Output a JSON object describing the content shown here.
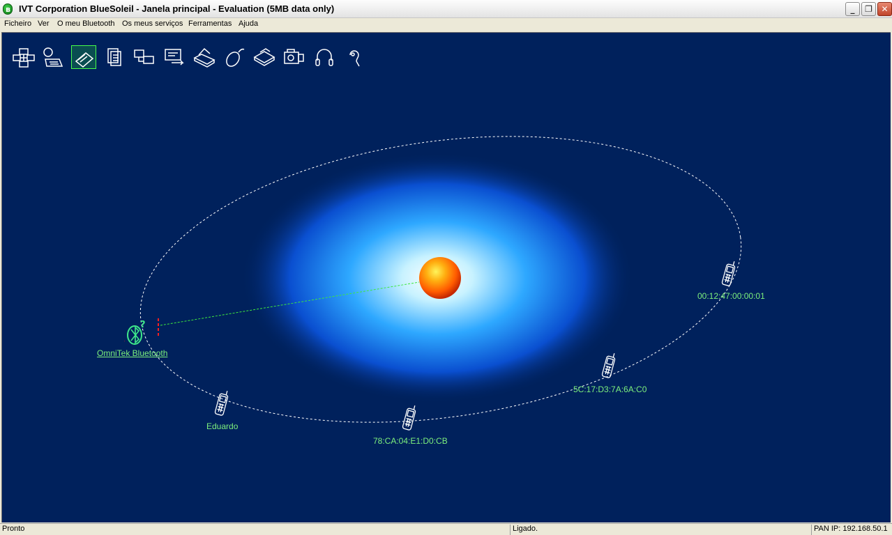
{
  "window": {
    "title": "IVT Corporation BlueSoleil - Janela principal - Evaluation (5MB data only)",
    "minimize_glyph": "_",
    "maximize_glyph": "❐",
    "close_glyph": "✕"
  },
  "menu": [
    "Ficheiro",
    "Ver",
    "O meu Bluetooth",
    "Os meus serviços",
    "Ferramentas",
    "Ajuda"
  ],
  "toolbar": {
    "icons": [
      {
        "name": "personal-area-network-icon",
        "active": false
      },
      {
        "name": "dial-up-networking-icon",
        "active": false
      },
      {
        "name": "file-transfer-icon",
        "active": true
      },
      {
        "name": "pim-synchronization-icon",
        "active": false
      },
      {
        "name": "lan-access-icon",
        "active": false
      },
      {
        "name": "serial-port-icon",
        "active": false
      },
      {
        "name": "printer-icon",
        "active": false
      },
      {
        "name": "mouse-icon",
        "active": false
      },
      {
        "name": "fax-icon",
        "active": false
      },
      {
        "name": "object-push-icon",
        "active": false
      },
      {
        "name": "headphones-icon",
        "active": false
      },
      {
        "name": "headset-icon",
        "active": false
      }
    ]
  },
  "local_device": {
    "label": "OmniTek Bluetooth",
    "icon": "bluetooth-adapter-icon"
  },
  "devices": [
    {
      "label": "00:12:47:00:00:01",
      "icon": "mobile-phone-icon"
    },
    {
      "label": "5C:17:D3:7A:6A:C0",
      "icon": "mobile-phone-icon"
    },
    {
      "label": "78:CA:04:E1:D0:CB",
      "icon": "mobile-phone-icon"
    },
    {
      "label": "Eduardo",
      "icon": "mobile-phone-icon"
    }
  ],
  "colors": {
    "background": "#00215c",
    "glow": "#1a7cff",
    "sun": "#ff7a00",
    "label": "#7df07d",
    "orbit": "#ffffff"
  },
  "status": {
    "left": "Pronto",
    "middle": "Ligado.",
    "right": "PAN IP: 192.168.50.1"
  }
}
